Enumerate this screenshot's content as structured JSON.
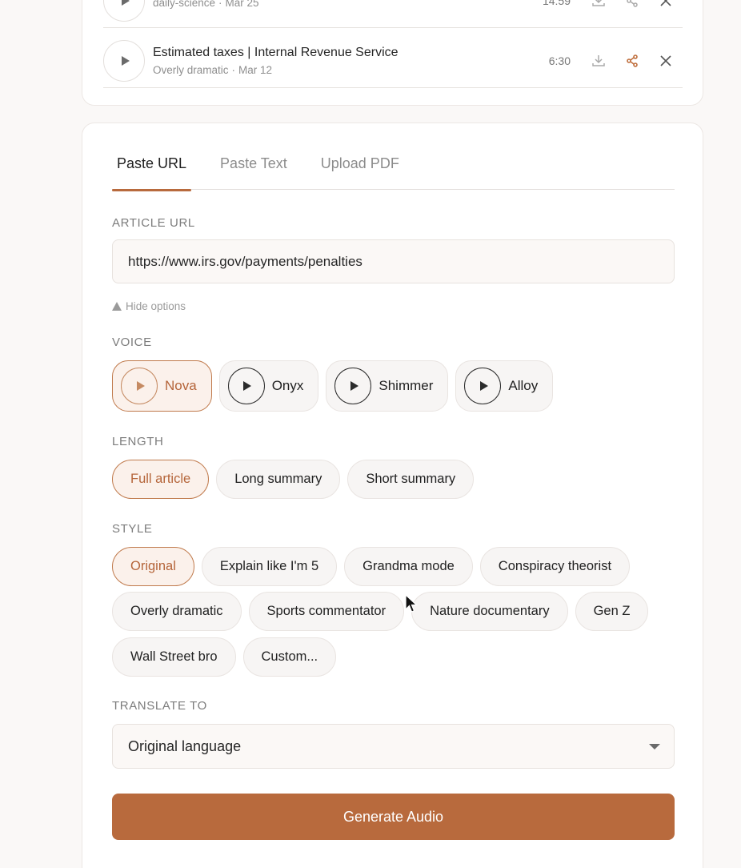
{
  "episodes": [
    {
      "title": "",
      "source": "daily-science",
      "date": "Mar 25",
      "duration": "14:59"
    },
    {
      "title": "Estimated taxes | Internal Revenue Service",
      "source": "Overly dramatic",
      "date": "Mar 12",
      "duration": "6:30"
    }
  ],
  "tabs": [
    "Paste URL",
    "Paste Text",
    "Upload PDF"
  ],
  "active_tab": "Paste URL",
  "article_url": {
    "label": "ARTICLE URL",
    "value": "https://www.irs.gov/payments/penalties"
  },
  "hide_options_label": "Hide options",
  "voice": {
    "label": "VOICE",
    "options": [
      "Nova",
      "Onyx",
      "Shimmer",
      "Alloy"
    ],
    "selected": "Nova"
  },
  "length": {
    "label": "LENGTH",
    "options": [
      "Full article",
      "Long summary",
      "Short summary"
    ],
    "selected": "Full article"
  },
  "style": {
    "label": "STYLE",
    "rows": [
      [
        "Original",
        "Explain like I'm 5",
        "Grandma mode",
        "Conspiracy theorist"
      ],
      [
        "Overly dramatic",
        "Sports commentator",
        "Nature documentary",
        "Gen Z"
      ],
      [
        "Wall Street bro",
        "Custom..."
      ]
    ],
    "selected": "Original"
  },
  "translate": {
    "label": "TRANSLATE TO",
    "value": "Original language"
  },
  "generate_label": "Generate Audio",
  "colors": {
    "accent": "#b86a3d",
    "selected_bg": "#fbf1eb",
    "selected_text": "#b5653a"
  }
}
